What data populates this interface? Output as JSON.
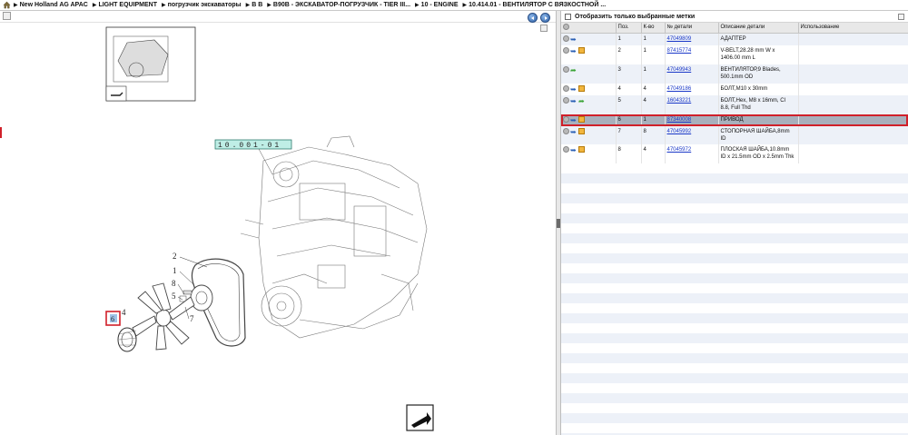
{
  "breadcrumb": [
    "New Holland AG APAC",
    "LIGHT EQUIPMENT",
    "погрузчик экскаваторы",
    "B B",
    "B90B - ЭКСКАВАТОР-ПОГРУЗЧИК - TIER III...",
    "10 - ENGINE",
    "10.414.01 - ВЕНТИЛЯТОР С ВЯЗКОСТНОЙ ..."
  ],
  "diagram": {
    "ref_code": "10.001-01",
    "callouts": [
      "2",
      "1",
      "8",
      "5",
      "4",
      "7",
      "6"
    ]
  },
  "filter": {
    "label": "Отобразить только выбранные метки"
  },
  "table": {
    "headers": [
      "",
      "Поз.",
      "К-во",
      "№ детали",
      "Описание детали",
      "Использование"
    ],
    "rows": [
      {
        "pos": "1",
        "qty": "1",
        "part": "47049809",
        "desc": "АДАПТЕР",
        "icons": [
          "dot",
          "arrow"
        ]
      },
      {
        "pos": "2",
        "qty": "1",
        "part": "87415774",
        "desc": "V-BELT,28.28 mm W x 1406.00 mm L",
        "icons": [
          "dot",
          "arrow",
          "box"
        ]
      },
      {
        "pos": "3",
        "qty": "1",
        "part": "47049943",
        "desc": "ВЕНТИЛЯТОР,9 Blades, 500.1mm OD",
        "icons": [
          "dot",
          "arrow-green"
        ]
      },
      {
        "pos": "4",
        "qty": "4",
        "part": "47049186",
        "desc": "БОЛТ,M10 x 30mm",
        "icons": [
          "dot",
          "arrow",
          "box"
        ]
      },
      {
        "pos": "5",
        "qty": "4",
        "part": "16043221",
        "desc": "БОЛТ,Hex, M8 x 16mm, Cl 8.8, Full Thd",
        "icons": [
          "dot",
          "arrow",
          "arrow-green"
        ]
      },
      {
        "pos": "6",
        "qty": "1",
        "part": "87340008",
        "desc": "ПРИВОД",
        "icons": [
          "dot",
          "arrow",
          "box"
        ],
        "selected": true
      },
      {
        "pos": "7",
        "qty": "8",
        "part": "47045992",
        "desc": "СТОПОРНАЯ ШАЙБА,8mm ID",
        "icons": [
          "dot",
          "arrow",
          "box"
        ]
      },
      {
        "pos": "8",
        "qty": "4",
        "part": "47045972",
        "desc": "ПЛОСКАЯ ШАЙБА,10.8mm ID x 21.5mm OD x 2.5mm Thk",
        "icons": [
          "dot",
          "arrow",
          "box"
        ]
      }
    ]
  },
  "colors": {
    "selection": "#a8b0bc",
    "highlight_border": "#d0202a",
    "link": "#1a38c8",
    "nav_button": "#2c5fa6"
  }
}
